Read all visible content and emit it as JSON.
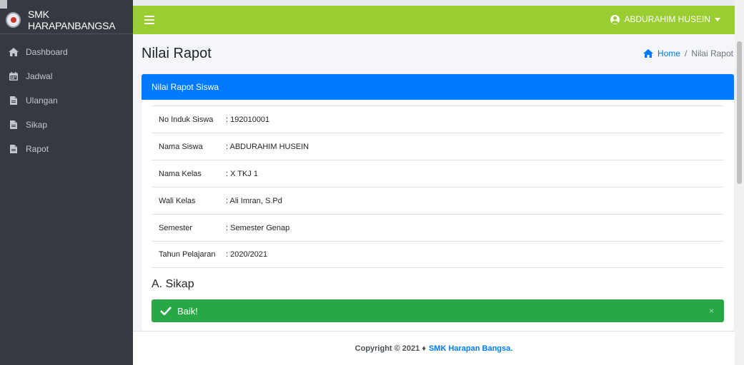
{
  "brand": {
    "name": "SMK HARAPANBANGSA"
  },
  "sidebar": {
    "items": [
      {
        "label": "Dashboard",
        "icon": "home-icon"
      },
      {
        "label": "Jadwal",
        "icon": "calendar-icon"
      },
      {
        "label": "Ulangan",
        "icon": "file-icon"
      },
      {
        "label": "Sikap",
        "icon": "file-icon"
      },
      {
        "label": "Rapot",
        "icon": "file-icon"
      }
    ]
  },
  "topbar": {
    "user_name": "ABDURAHIM HUSEIN"
  },
  "page": {
    "title": "Nilai Rapot",
    "breadcrumb": {
      "home": "Home",
      "separator": "/",
      "current": "Nilai Rapot"
    }
  },
  "card": {
    "header": "Nilai Rapot Siswa",
    "rows": [
      {
        "label": "No Induk Siswa",
        "value": ": 192010001"
      },
      {
        "label": "Nama Siswa",
        "value": ": ABDURAHIM HUSEIN"
      },
      {
        "label": "Nama Kelas",
        "value": ": X TKJ 1"
      },
      {
        "label": "Wali Kelas",
        "value": ": Ali Imran, S.Pd"
      },
      {
        "label": "Semester",
        "value": ": Semester Genap"
      },
      {
        "label": "Tahun Pelajaran",
        "value": ": 2020/2021"
      }
    ],
    "section_title": "A. Sikap",
    "alert_text": "Baik!",
    "alert_close": "×"
  },
  "footer": {
    "prefix": "Copyright © 2021 ♦",
    "brand": "SMK Harapan Bangsa."
  },
  "colors": {
    "topbar": "#9acd32",
    "sidebar": "#343a40",
    "card_header": "#007bff",
    "alert": "#28a745"
  }
}
